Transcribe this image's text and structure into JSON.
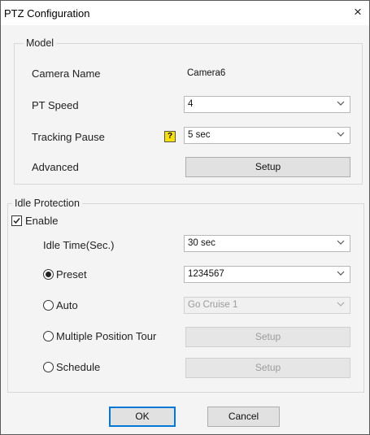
{
  "window": {
    "title": "PTZ Configuration",
    "close_glyph": "×"
  },
  "model": {
    "group_label": "Model",
    "camera_name_label": "Camera Name",
    "camera_name_value": "Camera6",
    "pt_speed_label": "PT Speed",
    "pt_speed_value": "4",
    "tracking_pause_label": "Tracking Pause",
    "tracking_pause_help": "?",
    "tracking_pause_value": "5 sec",
    "advanced_label": "Advanced",
    "advanced_button": "Setup"
  },
  "idle": {
    "group_label": "Idle Protection",
    "enable_label": "Enable",
    "enable_checked": true,
    "idle_time_label": "Idle Time(Sec.)",
    "idle_time_value": "30 sec",
    "preset_label": "Preset",
    "preset_selected": true,
    "preset_value": "1234567",
    "auto_label": "Auto",
    "auto_value": "Go Cruise 1",
    "tour_label": "Multiple Position Tour",
    "tour_button": "Setup",
    "schedule_label": "Schedule",
    "schedule_button": "Setup"
  },
  "footer": {
    "ok": "OK",
    "cancel": "Cancel"
  },
  "icons": {
    "close": "close-icon",
    "dropdown": "chevron-down-icon",
    "help": "help-icon",
    "checkbox": "checkmark-icon",
    "radio": "radio-dot-icon"
  },
  "colors": {
    "help_badge": "#f8e000",
    "primary_border": "#0078d7"
  }
}
